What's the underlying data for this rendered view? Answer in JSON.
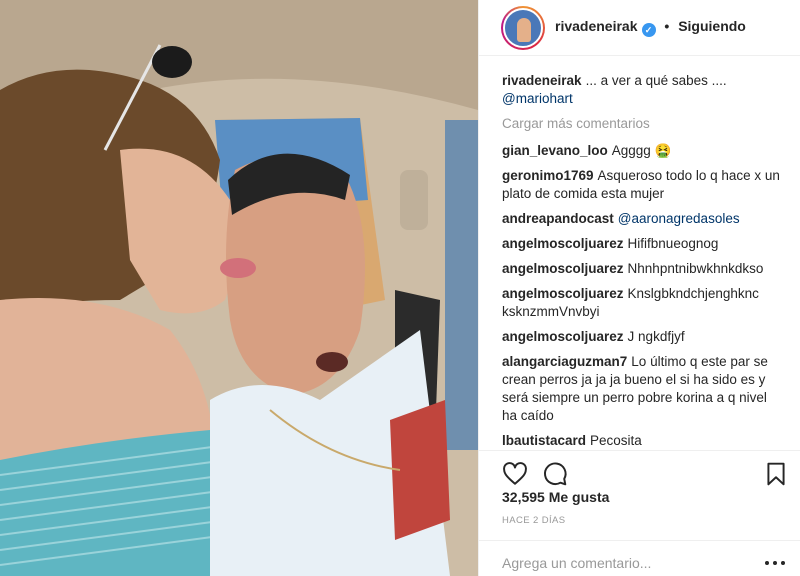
{
  "post": {
    "author": "rivadeneirak",
    "follow_status": "Siguiendo",
    "separator": "•",
    "verified_mark": "✓"
  },
  "caption": {
    "user": "rivadeneirak",
    "text": "... a ver a qué sabes ....",
    "mention": "@mariohart"
  },
  "load_more": "Cargar más comentarios",
  "comments": [
    {
      "user": "gian_levano_loo",
      "text": "Agggg 🤮"
    },
    {
      "user": "geronimo1769",
      "text": "Asqueroso todo lo q hace x un plato de comida esta mujer"
    },
    {
      "user": "andreapandocast",
      "text": "@aaronagredasoles"
    },
    {
      "user": "angelmoscoljuarez",
      "text": "Hififbnueognog"
    },
    {
      "user": "angelmoscoljuarez",
      "text": "Nhnhpntnibwkhnkdkso"
    },
    {
      "user": "angelmoscoljuarez",
      "text": "Knslgbkndchjenghknc ksknzmmVnvbyi"
    },
    {
      "user": "angelmoscoljuarez",
      "text": "J ngkdfjyf"
    },
    {
      "user": "alangarciaguzman7",
      "text": "Lo último q este par se crean perros ja ja ja bueno el si ha sido es y será siempre un perro pobre korina a q nivel ha caído"
    },
    {
      "user": "lbautistacard",
      "text": "Pecosita"
    }
  ],
  "icons": {
    "like": "heart-icon",
    "comment": "comment-bubble-icon",
    "save": "bookmark-icon",
    "more": "more-options-icon"
  },
  "likes": "32,595 Me gusta",
  "timestamp": "HACE 2 DÍAS",
  "add_comment": {
    "placeholder": "Agrega un comentario..."
  },
  "colors": {
    "text": "#262626",
    "secondary": "#999999",
    "link": "#003569",
    "verified": "#3897f0",
    "border": "#efefef"
  }
}
